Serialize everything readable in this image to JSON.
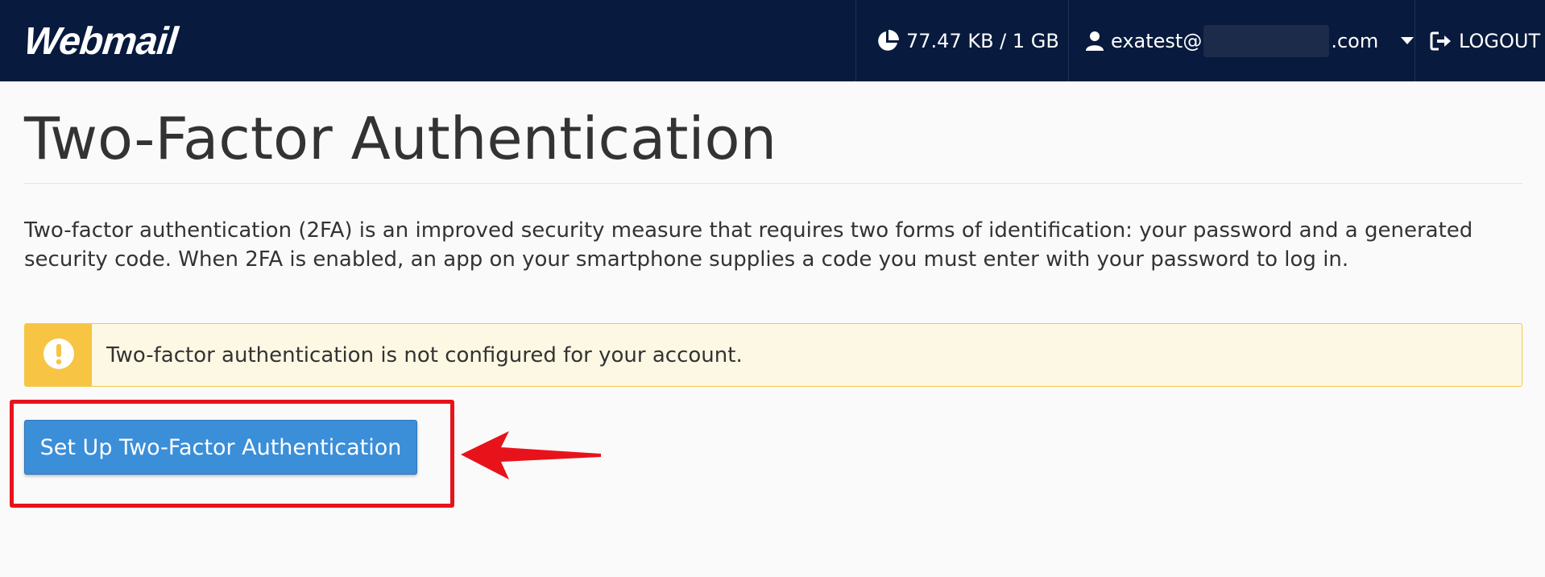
{
  "header": {
    "logo_text": "Webmail",
    "quota": {
      "icon": "pie-chart-icon",
      "text": "77.47 KB / 1 GB"
    },
    "user": {
      "icon": "user-icon",
      "email_prefix": "exatest@",
      "email_suffix": ".com",
      "dropdown_icon": "caret-down-icon"
    },
    "logout": {
      "icon": "sign-out-icon",
      "label": "LOGOUT"
    }
  },
  "page": {
    "title": "Two-Factor Authentication",
    "description": "Two-factor authentication (2FA) is an improved security measure that requires two forms of identification: your password and a generated security code. When 2FA is enabled, an app on your smartphone supplies a code you must enter with your password to log in."
  },
  "alert": {
    "icon": "exclamation-icon",
    "text": "Two-factor authentication is not configured for your account."
  },
  "setup_button": {
    "label": "Set Up Two-Factor Authentication"
  },
  "annotation": {
    "highlight_color": "#e8131a",
    "arrow_color": "#e8131a"
  },
  "colors": {
    "header_bg": "#081a3d",
    "primary": "#3b8ed8",
    "warning": "#f7c443",
    "warning_bg": "#fdf8e3"
  }
}
